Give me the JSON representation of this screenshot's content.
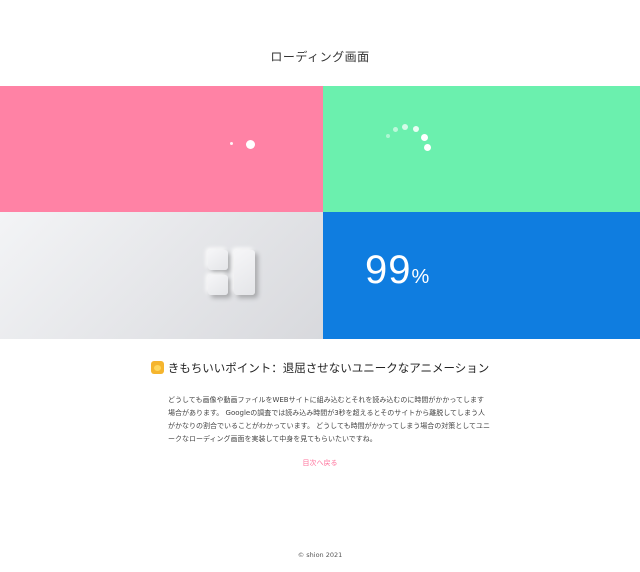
{
  "header": {
    "title": "ローディング画面"
  },
  "panels": {
    "pink": {
      "color": "#ff82a5",
      "icon": "pulse-dots-icon"
    },
    "green": {
      "color": "#6bf0ae",
      "icon": "spinner-dots-icon"
    },
    "gray": {
      "icon": "block-tiles-icon"
    },
    "blue": {
      "color": "#0f7de0",
      "counter_value": "99",
      "counter_unit": "%"
    }
  },
  "point": {
    "icon": "smiling-face-emoji-icon",
    "heading": "きもちいいポイント：退屈させないユニークなアニメーション"
  },
  "body": {
    "line1": "どうしても画像や動画ファイルをWEBサイトに組み込むとそれを読み込むのに時間がかかってします",
    "line2": "場合があります。 Googleの調査では読み込み時間が3秒を超えるとそのサイトから離脱してしまう人",
    "line3": "がかなりの割合でいることがわかっています。 どうしても時間がかかってしまう場合の対策としてユニ",
    "line4": "ークなローディング画面を実装して中身を見てもらいたいですね。"
  },
  "nav": {
    "toc_link": "目次へ戻る",
    "link_color": "#ff6f9a"
  },
  "footer": {
    "copyright": "© shion 2021"
  }
}
